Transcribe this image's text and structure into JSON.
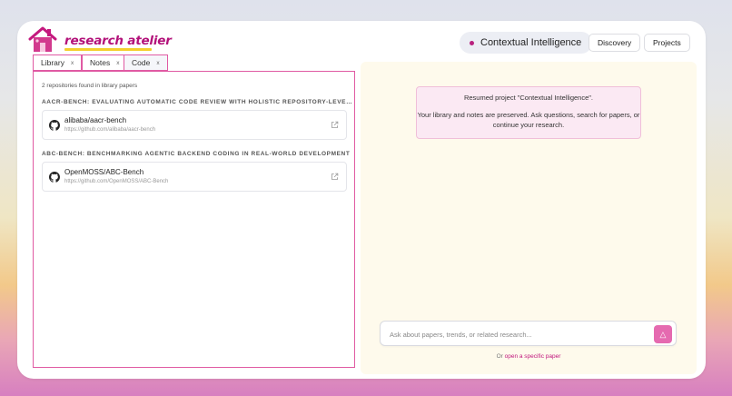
{
  "app": {
    "brand": "research atelier"
  },
  "header": {
    "project": "Contextual Intelligence",
    "buttons": {
      "discovery": "Discovery",
      "projects": "Projects"
    }
  },
  "tabs": [
    {
      "label": "Library",
      "close": "x"
    },
    {
      "label": "Notes",
      "close": "x"
    },
    {
      "label": "Code",
      "close": "x",
      "active": true
    }
  ],
  "code_panel": {
    "count_text": "2 repositories found in library papers",
    "groups": [
      {
        "paper": "AACR-BENCH: EVALUATING AUTOMATIC CODE REVIEW WITH HOLISTIC REPOSITORY-LEVE…",
        "repo": {
          "name": "alibaba/aacr-bench",
          "url": "https://github.com/alibaba/aacr-bench"
        }
      },
      {
        "paper": "ABC-BENCH: BENCHMARKING AGENTIC BACKEND CODING IN REAL-WORLD DEVELOPMENT",
        "repo": {
          "name": "OpenMOSS/ABC-Bench",
          "url": "https://github.com/OpenMOSS/ABC-Bench"
        }
      }
    ]
  },
  "chat": {
    "message_line1": "Resumed project \"Contextual Intelligence\".",
    "message_line2": "Your library and notes are preserved. Ask questions, search for papers, or continue your research.",
    "input_placeholder": "Ask about papers, trends, or related research...",
    "footer_prefix": "Or",
    "footer_link": "open a specific paper"
  },
  "colors": {
    "accent": "#e05aa3",
    "brand": "#b3127a",
    "highlight": "#f4cf2c"
  },
  "icons": {
    "logo": "house-logo-icon",
    "github": "github-icon",
    "external": "external-link-icon",
    "send": "send-icon"
  }
}
